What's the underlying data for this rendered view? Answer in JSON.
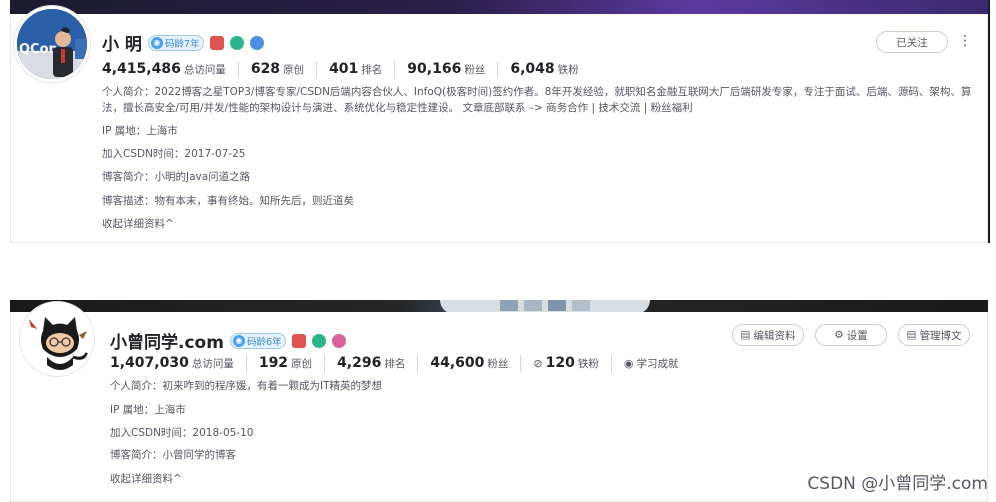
{
  "profiles": [
    {
      "name": "小 明",
      "code_age": "码龄7年",
      "stats": [
        {
          "value": "4,415,486",
          "label": "总访问量"
        },
        {
          "value": "628",
          "label": "原创"
        },
        {
          "value": "401",
          "label": "排名"
        },
        {
          "value": "90,166",
          "label": "粉丝"
        },
        {
          "value": "6,048",
          "label": "铁粉"
        }
      ],
      "intro_label": "个人简介：",
      "intro_line1": "2022博客之星TOP3/博客专家/CSDN后端内容合伙人、InfoQ(极客时间)签约作者。8年开发经验，就职知名金融互联网大厂后端研发专家，专注于面试、后端、源码、架构、算",
      "intro_line2": "法，擅长高安全/可用/并发/性能的架构设计与演进、系统优化与稳定性建设。 文章底部联系 –> 商务合作 | 技术交流 | 粉丝福利",
      "ip": "IP 属地：上海市",
      "join": "加入CSDN时间：2017-07-25",
      "blog_intro": "博客简介：小明的Java问道之路",
      "blog_desc": "博客描述：物有本末，事有终始。知所先后，则近道矣",
      "collapse": "收起详细资料^",
      "follow_btn": "已关注"
    },
    {
      "name": "小曾同学.com",
      "code_age": "码龄6年",
      "stats": [
        {
          "value": "1,407,030",
          "label": "总访问量"
        },
        {
          "value": "192",
          "label": "原创"
        },
        {
          "value": "4,296",
          "label": "排名"
        },
        {
          "value": "44,600",
          "label": "粉丝"
        },
        {
          "value": "120",
          "label": "铁粉"
        },
        {
          "value": "",
          "label": "学习成就"
        }
      ],
      "intro": "个人简介：初来咋到的程序媛，有着一颗成为IT精英的梦想",
      "ip": "IP 属地：上海市",
      "join": "加入CSDN时间：2018-05-10",
      "blog_intro": "博客简介：小曾同学的博客",
      "collapse": "收起详细资料^",
      "buttons": {
        "edit": "编辑资料",
        "settings": "设置",
        "manage": "管理博文"
      }
    }
  ],
  "watermark": "CSDN @小曾同学.com",
  "avatar_text": "QCon",
  "colors": {
    "badge_blue": "#3a89d8",
    "badge_bg": "#e6f2ff",
    "text_main": "#222226",
    "text_sub": "#555666"
  }
}
